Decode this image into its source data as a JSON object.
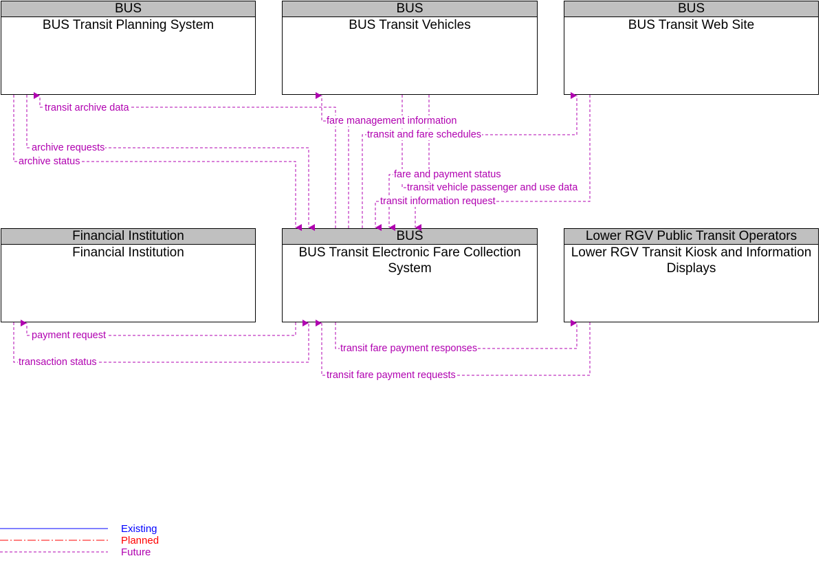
{
  "boxes": {
    "planning": {
      "header": "BUS",
      "title": "BUS Transit Planning System"
    },
    "vehicles": {
      "header": "BUS",
      "title": "BUS Transit Vehicles"
    },
    "website": {
      "header": "BUS",
      "title": "BUS Transit Web Site"
    },
    "financial": {
      "header": "Financial Institution",
      "title": "Financial Institution"
    },
    "efc": {
      "header": "BUS",
      "title": "BUS Transit Electronic Fare Collection System"
    },
    "kiosk": {
      "header": "Lower RGV Public Transit Operators",
      "title": "Lower RGV Transit Kiosk and Information Displays"
    }
  },
  "flows": {
    "transit_archive_data": "transit archive data",
    "fare_management_information": "fare management information",
    "transit_and_fare_schedules": "transit and fare schedules",
    "archive_requests": "archive requests",
    "archive_status": "archive status",
    "fare_and_payment_status": "fare and payment status",
    "transit_vehicle_passenger_and_use_data": "transit vehicle passenger and use data",
    "transit_information_request": "transit information request",
    "payment_request": "payment request",
    "transaction_status": "transaction status",
    "transit_fare_payment_responses": "transit fare payment responses",
    "transit_fare_payment_requests": "transit fare payment requests"
  },
  "legend": {
    "existing": {
      "label": "Existing",
      "color": "#0000ff"
    },
    "planned": {
      "label": "Planned",
      "color": "#ff0000"
    },
    "future": {
      "label": "Future",
      "color": "#b000b0"
    }
  },
  "colors": {
    "flow": "#b000b0",
    "header_bg": "#c0c0c0"
  }
}
